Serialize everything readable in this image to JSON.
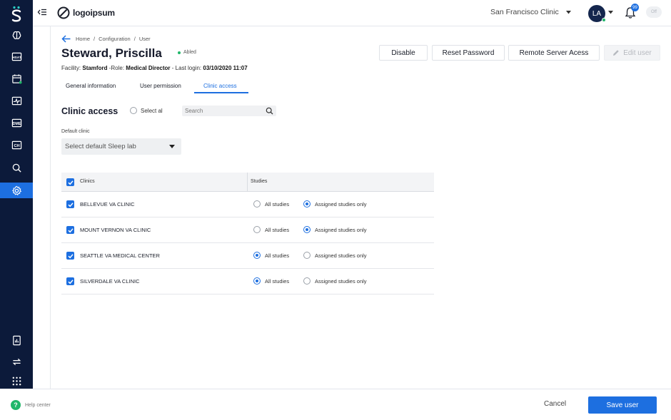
{
  "topbar": {
    "logo_text": "logoipsum",
    "clinic_name": "San Francisco Clinic",
    "avatar_initials": "LA",
    "notification_count": "99",
    "toggle_label": "Off"
  },
  "sidebar": {
    "items": [
      {
        "icon": "brain-icon"
      },
      {
        "icon": "hsat-icon",
        "text": "HSAT"
      },
      {
        "icon": "calendar-icon"
      },
      {
        "icon": "activity-icon"
      },
      {
        "icon": "dme-icon",
        "text": "DME"
      },
      {
        "icon": "chart-icon",
        "text": "CH"
      },
      {
        "icon": "search-icon"
      },
      {
        "icon": "settings-icon",
        "active": true
      },
      {
        "icon": "report-icon"
      },
      {
        "icon": "sync-icon"
      },
      {
        "icon": "apps-grid-icon"
      }
    ]
  },
  "breadcrumb": [
    "Home",
    "Configuration",
    "User"
  ],
  "user": {
    "name": "Steward, Priscilla",
    "status": "Abled",
    "facility_label": "Facility:",
    "facility": "Stamford",
    "role_label": "-Role:",
    "role": "Medical Director",
    "last_login_label": "- Last login:",
    "last_login": "03/10/2020 11:07"
  },
  "actions": {
    "disable": "Disable",
    "reset_password": "Reset Password",
    "remote_access": "Remote Server Acess",
    "edit_user": "Edit user"
  },
  "tabs": [
    "General information",
    "User permission",
    "Clinic access"
  ],
  "clinic_access": {
    "title": "Clinic access",
    "select_all": "Select al",
    "search_placeholder": "Search",
    "default_clinic_label": "Default clinic",
    "default_clinic_placeholder": "Select default Sleep lab"
  },
  "table": {
    "headers": {
      "clinics": "Clinics",
      "studies": "Studies"
    },
    "option_labels": {
      "all": "All studies",
      "assigned": "Assigned studies only"
    },
    "rows": [
      {
        "clinic": "BELLEVUE VA CLINIC",
        "checked": true,
        "selected": "assigned"
      },
      {
        "clinic": "MOUNT VERNON VA CLINIC",
        "checked": true,
        "selected": "assigned"
      },
      {
        "clinic": "SEATTLE VA MEDICAL CENTER",
        "checked": true,
        "selected": "all"
      },
      {
        "clinic": "SILVERDALE VA CLINIC",
        "checked": true,
        "selected": "all"
      }
    ]
  },
  "footer": {
    "help": "Help center",
    "cancel": "Cancel",
    "save": "Save user"
  },
  "colors": {
    "sidebar": "#0c1a3a",
    "accent": "#1d6fe0",
    "success": "#21b76a"
  }
}
